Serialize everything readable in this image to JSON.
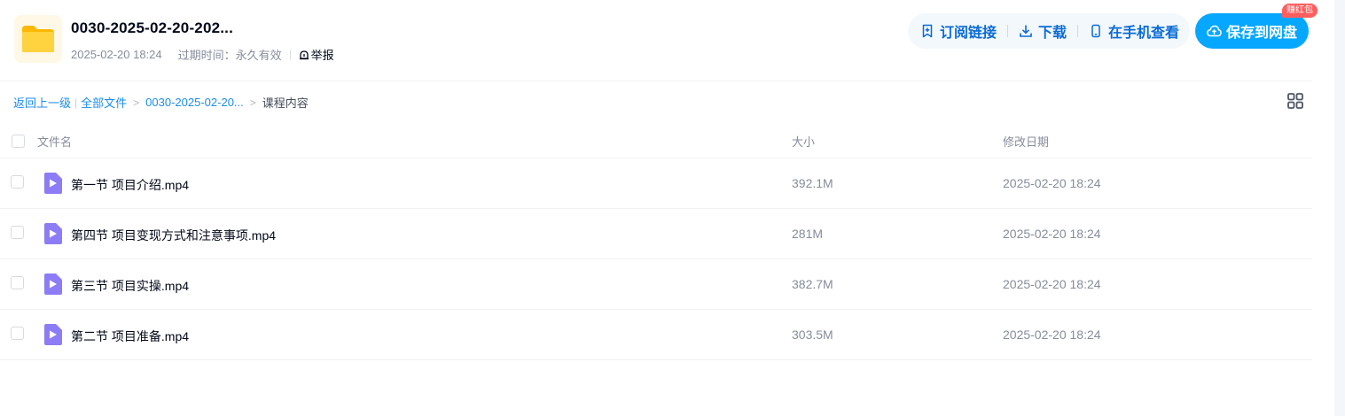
{
  "header": {
    "title": "0030-2025-02-20-202...",
    "date": "2025-02-20 18:24",
    "expire": "过期时间：永久有效",
    "report": "举报",
    "folder_color": "#FFC629"
  },
  "actions": {
    "subscribe": "订阅链接",
    "download": "下载",
    "phone_view": "在手机查看",
    "save": "保存到网盘",
    "badge": "赚红包"
  },
  "breadcrumb": {
    "back": "返回上一级",
    "all_files": "全部文件",
    "folder": "0030-2025-02-20...",
    "current": "课程内容"
  },
  "table": {
    "headers": {
      "name": "文件名",
      "size": "大小",
      "date": "修改日期"
    },
    "rows": [
      {
        "name": "第一节 项目介绍.mp4",
        "size": "392.1M",
        "date": "2025-02-20 18:24",
        "icon": "video-icon"
      },
      {
        "name": "第四节 项目变现方式和注意事项.mp4",
        "size": "281M",
        "date": "2025-02-20 18:24",
        "icon": "video-icon"
      },
      {
        "name": "第三节 项目实操.mp4",
        "size": "382.7M",
        "date": "2025-02-20 18:24",
        "icon": "video-icon"
      },
      {
        "name": "第二节 项目准备.mp4",
        "size": "303.5M",
        "date": "2025-02-20 18:24",
        "icon": "video-icon"
      }
    ]
  },
  "colors": {
    "accent": "#06A7FF",
    "action_text": "#0A6BD6",
    "badge": "#FF5E5E",
    "video_icon": "#8C7CF6"
  }
}
